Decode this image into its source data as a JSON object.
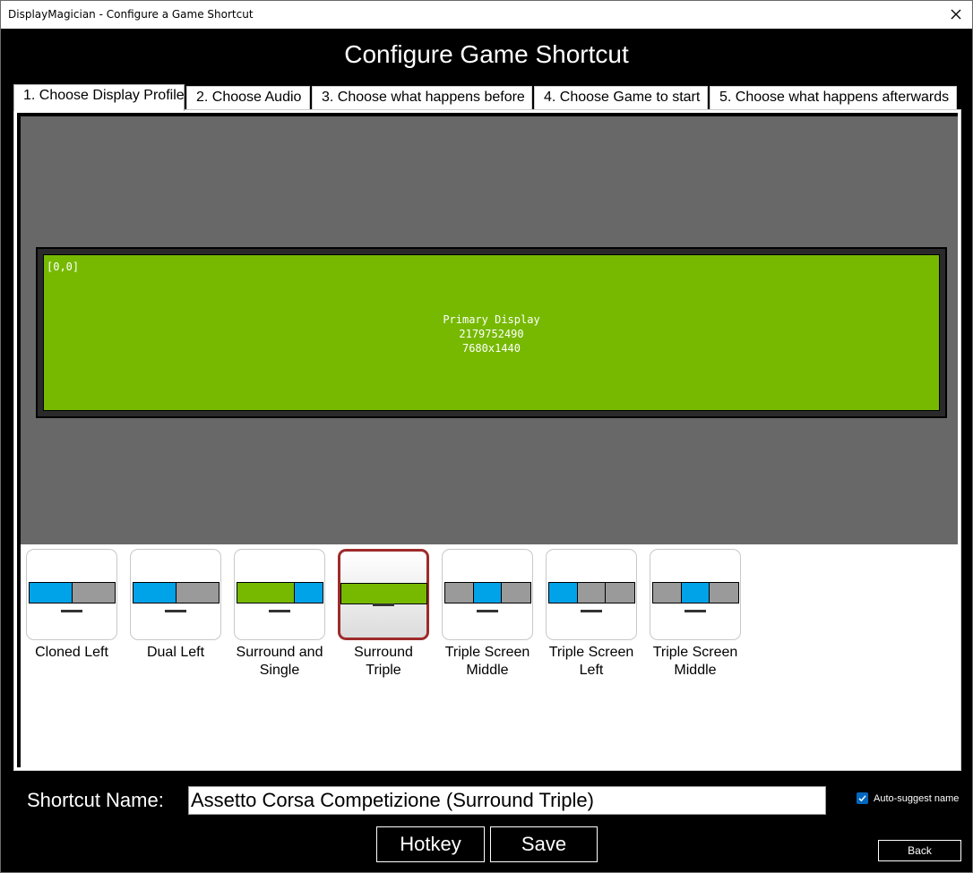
{
  "window": {
    "title": "DisplayMagician - Configure a Game Shortcut"
  },
  "heading": "Configure Game Shortcut",
  "tabs": [
    {
      "label": "1. Choose Display Profile",
      "active": true
    },
    {
      "label": "2. Choose Audio",
      "active": false
    },
    {
      "label": "3. Choose what happens before",
      "active": false
    },
    {
      "label": "4. Choose Game to start",
      "active": false
    },
    {
      "label": "5. Choose what happens afterwards",
      "active": false
    }
  ],
  "preview": {
    "coords": "[0,0]",
    "display_name": "Primary Display",
    "display_id": "2179752490",
    "resolution": "7680x1440"
  },
  "colors": {
    "nvidia_green": "#76b900",
    "blue": "#00a2e8",
    "gray": "#9a9a9a",
    "selected_border": "#9e2b2b"
  },
  "profiles": [
    {
      "label": "Cloned Left",
      "segments": [
        "blue",
        "gray"
      ],
      "selected": false
    },
    {
      "label": "Dual Left",
      "segments": [
        "blue",
        "gray"
      ],
      "selected": false
    },
    {
      "label": "Surround and Single",
      "segments": [
        "green",
        "blue"
      ],
      "selected": false
    },
    {
      "label": "Surround Triple",
      "segments": [
        "green"
      ],
      "selected": true
    },
    {
      "label": "Triple Screen Middle",
      "segments": [
        "gray",
        "blue",
        "gray"
      ],
      "selected": false
    },
    {
      "label": "Triple Screen Left",
      "segments": [
        "blue",
        "gray",
        "gray"
      ],
      "selected": false
    },
    {
      "label": "Triple Screen Middle",
      "segments": [
        "gray",
        "blue",
        "gray"
      ],
      "selected": false
    }
  ],
  "shortcut": {
    "name_label": "Shortcut Name:",
    "name_value": "Assetto Corsa Competizione (Surround Triple)",
    "auto_suggest_label": "Auto-suggest name",
    "auto_suggest_checked": true
  },
  "buttons": {
    "hotkey": "Hotkey",
    "save": "Save",
    "back": "Back"
  }
}
